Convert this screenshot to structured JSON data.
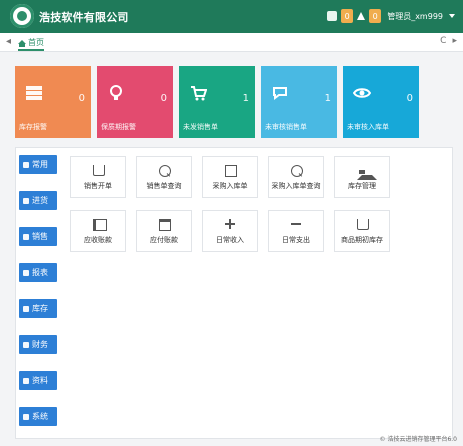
{
  "topbar": {
    "title": "浩技软件有限公司",
    "badge_count": "0",
    "badge_count_2": "0",
    "user_label": "管理员_xm999",
    "colors": {
      "topbar_bg": "#1f7a5a",
      "badge": "#f0ad4e"
    }
  },
  "tabs": {
    "home_label": "首页",
    "left_arrow": "◂",
    "tools": [
      "C",
      "▸"
    ]
  },
  "cards": [
    {
      "label": "库存报警",
      "value": "0",
      "color": "#f08a52",
      "icon": "server-icon"
    },
    {
      "label": "保质期报警",
      "value": "0",
      "color": "#e34b6f",
      "icon": "bulb-icon"
    },
    {
      "label": "未发销售单",
      "value": "1",
      "color": "#19a683",
      "icon": "cart-icon"
    },
    {
      "label": "未审核销售单",
      "value": "1",
      "color": "#49b9e3",
      "icon": "chat-icon"
    },
    {
      "label": "未审核入库单",
      "value": "0",
      "color": "#17a8d8",
      "icon": "eye-icon"
    }
  ],
  "sidebar": {
    "items": [
      {
        "label": "常用",
        "icon": "pencil-icon"
      },
      {
        "label": "进货",
        "icon": "book-icon"
      },
      {
        "label": "销售",
        "icon": "cart-icon"
      },
      {
        "label": "报表",
        "icon": "chart-icon"
      },
      {
        "label": "库存",
        "icon": "home-icon"
      },
      {
        "label": "财务",
        "icon": "grid-icon"
      },
      {
        "label": "资料",
        "icon": "list-icon"
      },
      {
        "label": "系统",
        "icon": "gear-icon"
      }
    ],
    "colors": {
      "button_bg": "#2d7fd6"
    }
  },
  "quick": {
    "row1": [
      {
        "label": "销售开单",
        "icon": "cart-icon"
      },
      {
        "label": "销售单查询",
        "icon": "search-icon"
      },
      {
        "label": "采购入库单",
        "icon": "doc-icon"
      },
      {
        "label": "采购入库单查询",
        "icon": "search-icon"
      },
      {
        "label": "库存管理",
        "icon": "home-icon"
      }
    ],
    "row2": [
      {
        "label": "应收账款",
        "icon": "megaphone-icon"
      },
      {
        "label": "应付账款",
        "icon": "calendar-icon"
      },
      {
        "label": "日常收入",
        "icon": "plus-icon"
      },
      {
        "label": "日常支出",
        "icon": "minus-icon"
      },
      {
        "label": "商品期初库存",
        "icon": "cart-icon"
      }
    ]
  },
  "footer": {
    "text": "© 浩技云进销存管理平台6.0"
  }
}
